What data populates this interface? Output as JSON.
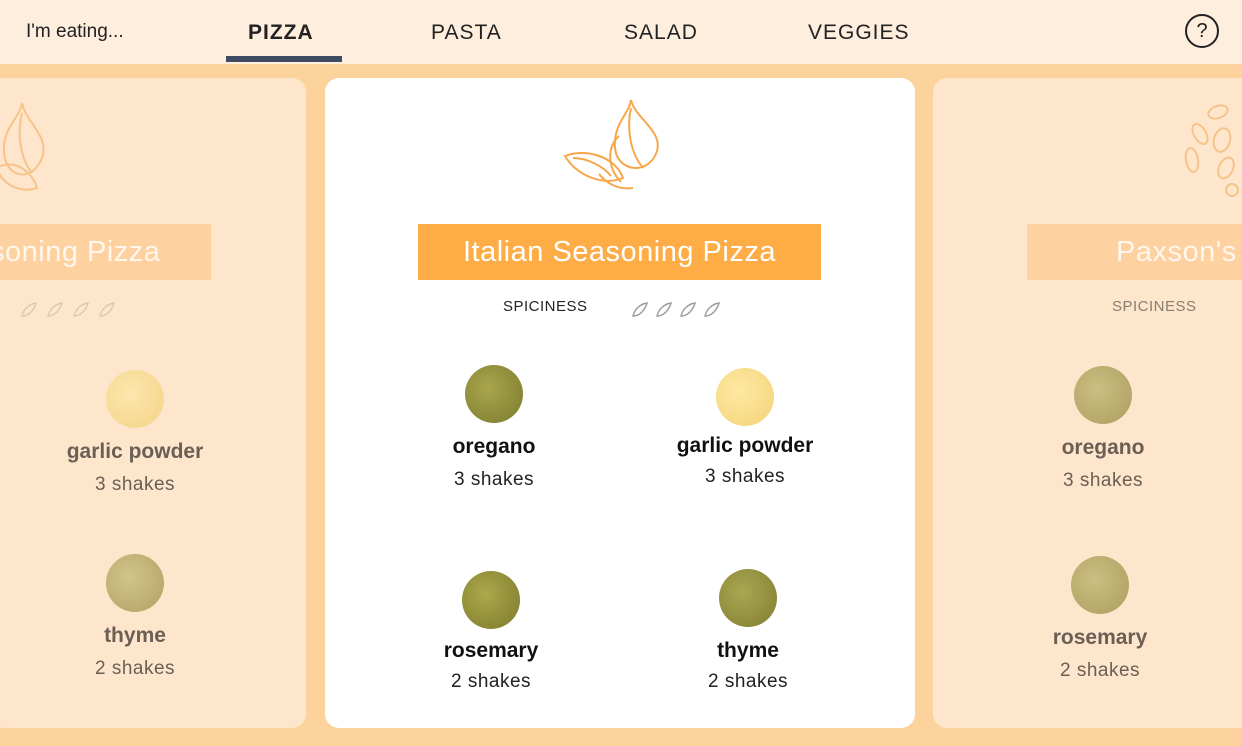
{
  "header": {
    "prompt": "I'm eating...",
    "tabs": [
      "PIZZA",
      "PASTA",
      "SALAD",
      "VEGGIES"
    ],
    "active_tab": "PIZZA",
    "help": "?"
  },
  "colors": {
    "accent": "#feac45",
    "tab_underline": "#3f4a63",
    "stage": "#fcd39d"
  },
  "cards": {
    "left": {
      "title": "soning Pizza",
      "ingredients": [
        {
          "name": "garlic powder",
          "qty": "3 shakes",
          "color": "#f6d98c"
        },
        {
          "name": "thyme",
          "qty": "2 shakes",
          "color": "#b3a25c"
        }
      ]
    },
    "center": {
      "title": "Italian Seasoning Pizza",
      "spiciness_label": "SPICINESS",
      "ingredients": [
        {
          "name": "oregano",
          "qty": "3 shakes",
          "color": "#8c8a3a"
        },
        {
          "name": "garlic powder",
          "qty": "3 shakes",
          "color": "#f6d98c"
        },
        {
          "name": "rosemary",
          "qty": "2 shakes",
          "color": "#908a35"
        },
        {
          "name": "thyme",
          "qty": "2 shakes",
          "color": "#8f8c3e"
        }
      ]
    },
    "right": {
      "title": "Paxson's",
      "spiciness_label": "SPICINESS",
      "ingredients": [
        {
          "name": "oregano",
          "qty": "3 shakes",
          "color": "#a5994f"
        },
        {
          "name": "rosemary",
          "qty": "2 shakes",
          "color": "#a5994f"
        }
      ]
    }
  }
}
